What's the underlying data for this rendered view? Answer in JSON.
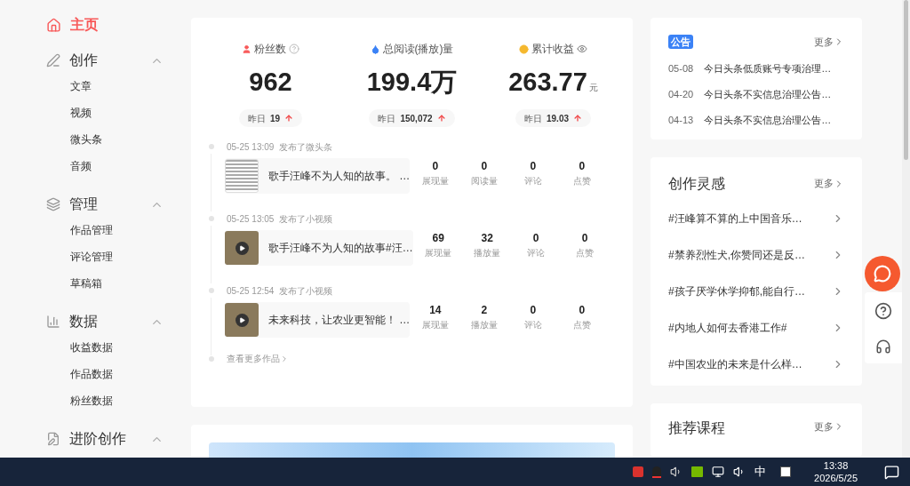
{
  "sidebar": {
    "home": {
      "label": "主页",
      "selected": true
    },
    "groups": [
      {
        "label": "创作",
        "expanded": true,
        "items": [
          {
            "label": "文章"
          },
          {
            "label": "视频"
          },
          {
            "label": "微头条"
          },
          {
            "label": "音频"
          }
        ]
      },
      {
        "label": "管理",
        "expanded": true,
        "items": [
          {
            "label": "作品管理"
          },
          {
            "label": "评论管理"
          },
          {
            "label": "草稿箱"
          }
        ]
      },
      {
        "label": "数据",
        "expanded": true,
        "items": [
          {
            "label": "收益数据"
          },
          {
            "label": "作品数据"
          },
          {
            "label": "粉丝数据"
          }
        ]
      },
      {
        "label": "进阶创作",
        "expanded": true
      }
    ]
  },
  "stats": [
    {
      "kind": "fans",
      "label": "粉丝数",
      "value": "962",
      "yesterday_label": "昨日",
      "yesterday_value": "19"
    },
    {
      "kind": "reads",
      "label": "总阅读(播放)量",
      "value": "199.4万",
      "yesterday_label": "昨日",
      "yesterday_value": "150,072"
    },
    {
      "kind": "income",
      "label": "累计收益",
      "value": "263.77",
      "unit": "元",
      "yesterday_label": "昨日",
      "yesterday_value": "19.03"
    }
  ],
  "works": [
    {
      "time": "05-25 13:09",
      "action": "发布了微头条",
      "kind": "post",
      "title": "歌手汪峰不为人知的故事。 …",
      "metrics": [
        {
          "value": "0",
          "label": "展现量"
        },
        {
          "value": "0",
          "label": "阅读量"
        },
        {
          "value": "0",
          "label": "评论"
        },
        {
          "value": "0",
          "label": "点赞"
        }
      ]
    },
    {
      "time": "05-25 13:05",
      "action": "发布了小视频",
      "kind": "video",
      "title": "歌手汪峰不为人知的故事#汪…",
      "metrics": [
        {
          "value": "69",
          "label": "展现量"
        },
        {
          "value": "32",
          "label": "播放量"
        },
        {
          "value": "0",
          "label": "评论"
        },
        {
          "value": "0",
          "label": "点赞"
        }
      ]
    },
    {
      "time": "05-25 12:54",
      "action": "发布了小视频",
      "kind": "video",
      "title": "未来科技，让农业更智能！ …",
      "metrics": [
        {
          "value": "14",
          "label": "展现量"
        },
        {
          "value": "2",
          "label": "播放量"
        },
        {
          "value": "0",
          "label": "评论"
        },
        {
          "value": "0",
          "label": "点赞"
        }
      ]
    }
  ],
  "more_works": "查看更多作品",
  "notices": {
    "badge": "公告",
    "more": "更多",
    "items": [
      {
        "date": "05-08",
        "title": "今日头条低质账号专项治理…"
      },
      {
        "date": "04-20",
        "title": "今日头条不实信息治理公告…"
      },
      {
        "date": "04-13",
        "title": "今日头条不实信息治理公告…"
      }
    ]
  },
  "inspiration": {
    "title": "创作灵感",
    "more": "更多",
    "items": [
      "#汪峰算不算的上中国音乐…",
      "#禁养烈性犬,你赞同还是反…",
      "#孩子厌学休学抑郁,能自行…",
      "#内地人如何去香港工作#",
      "#中国农业的未来是什么样…"
    ]
  },
  "courses": {
    "title": "推荐课程",
    "more": "更多"
  },
  "taskbar": {
    "ime": "中",
    "time": "13:38",
    "date": "2026/5/25"
  }
}
